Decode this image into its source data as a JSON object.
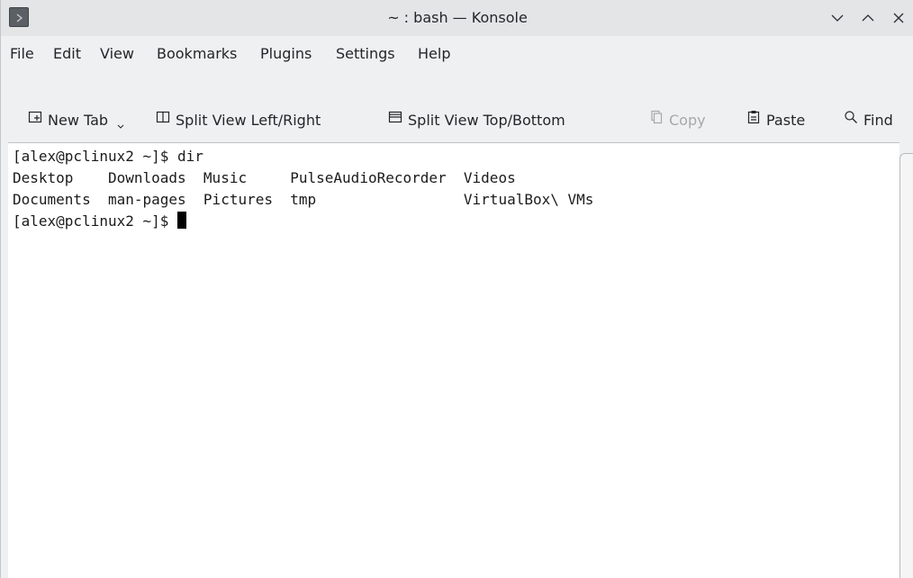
{
  "window": {
    "title": "~ : bash — Konsole"
  },
  "menubar": {
    "items": [
      "File",
      "Edit",
      "View",
      "Bookmarks",
      "Plugins",
      "Settings",
      "Help"
    ]
  },
  "toolbar": {
    "new_tab": "New Tab",
    "split_lr": "Split View Left/Right",
    "split_tb": "Split View Top/Bottom",
    "copy": "Copy",
    "paste": "Paste",
    "find": "Find"
  },
  "terminal": {
    "line1": "[alex@pclinux2 ~]$ dir",
    "line2": "Desktop    Downloads  Music     PulseAudioRecorder  Videos",
    "line3": "Documents  man-pages  Pictures  tmp                 VirtualBox\\ VMs",
    "prompt": "[alex@pclinux2 ~]$ "
  }
}
